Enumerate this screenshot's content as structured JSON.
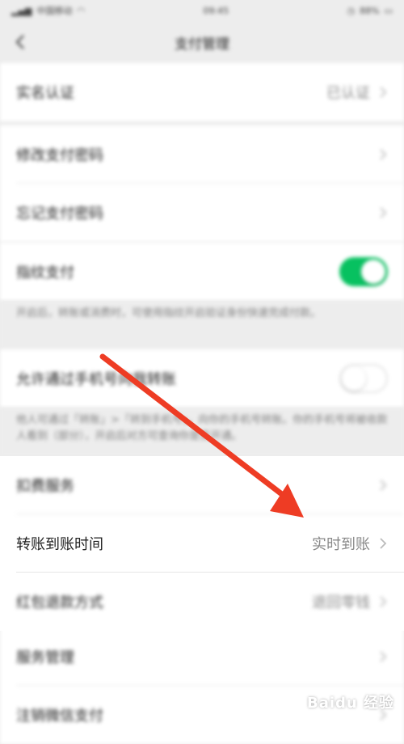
{
  "status_bar": {
    "carrier": "中国移动",
    "time": "09:45",
    "battery": "88%"
  },
  "nav": {
    "title": "支付管理"
  },
  "groups": {
    "g1": {
      "label": "实名认证",
      "value": "已认证"
    },
    "g2": {
      "item1": "修改支付密码",
      "item2": "忘记支付密码"
    },
    "g3": {
      "label": "指纹支付",
      "toggle_on": true,
      "desc": "开启后，转账或消费时，可使用指纹开启验证身份快速完成付款。"
    },
    "g4": {
      "label": "允许通过手机号向我转账",
      "toggle_on": false,
      "desc": "他人可通过「转账」>「转到手机号」，向你的手机号转账。你的手机号将被收款人看到（部分），开启后对方可查询你是否开通。"
    },
    "g5": {
      "item1": "扣费服务",
      "item2": "转账到账时间",
      "item2_value": "实时到账",
      "item3": "红包退款方式",
      "item3_value": "退回零钱"
    },
    "g6": {
      "item1": "服务管理",
      "item2": "注销微信支付"
    }
  },
  "watermark": "Baidu 经验",
  "colors": {
    "accent_green": "#07c160",
    "arrow_red": "#ee3c24",
    "background": "#ededed"
  }
}
